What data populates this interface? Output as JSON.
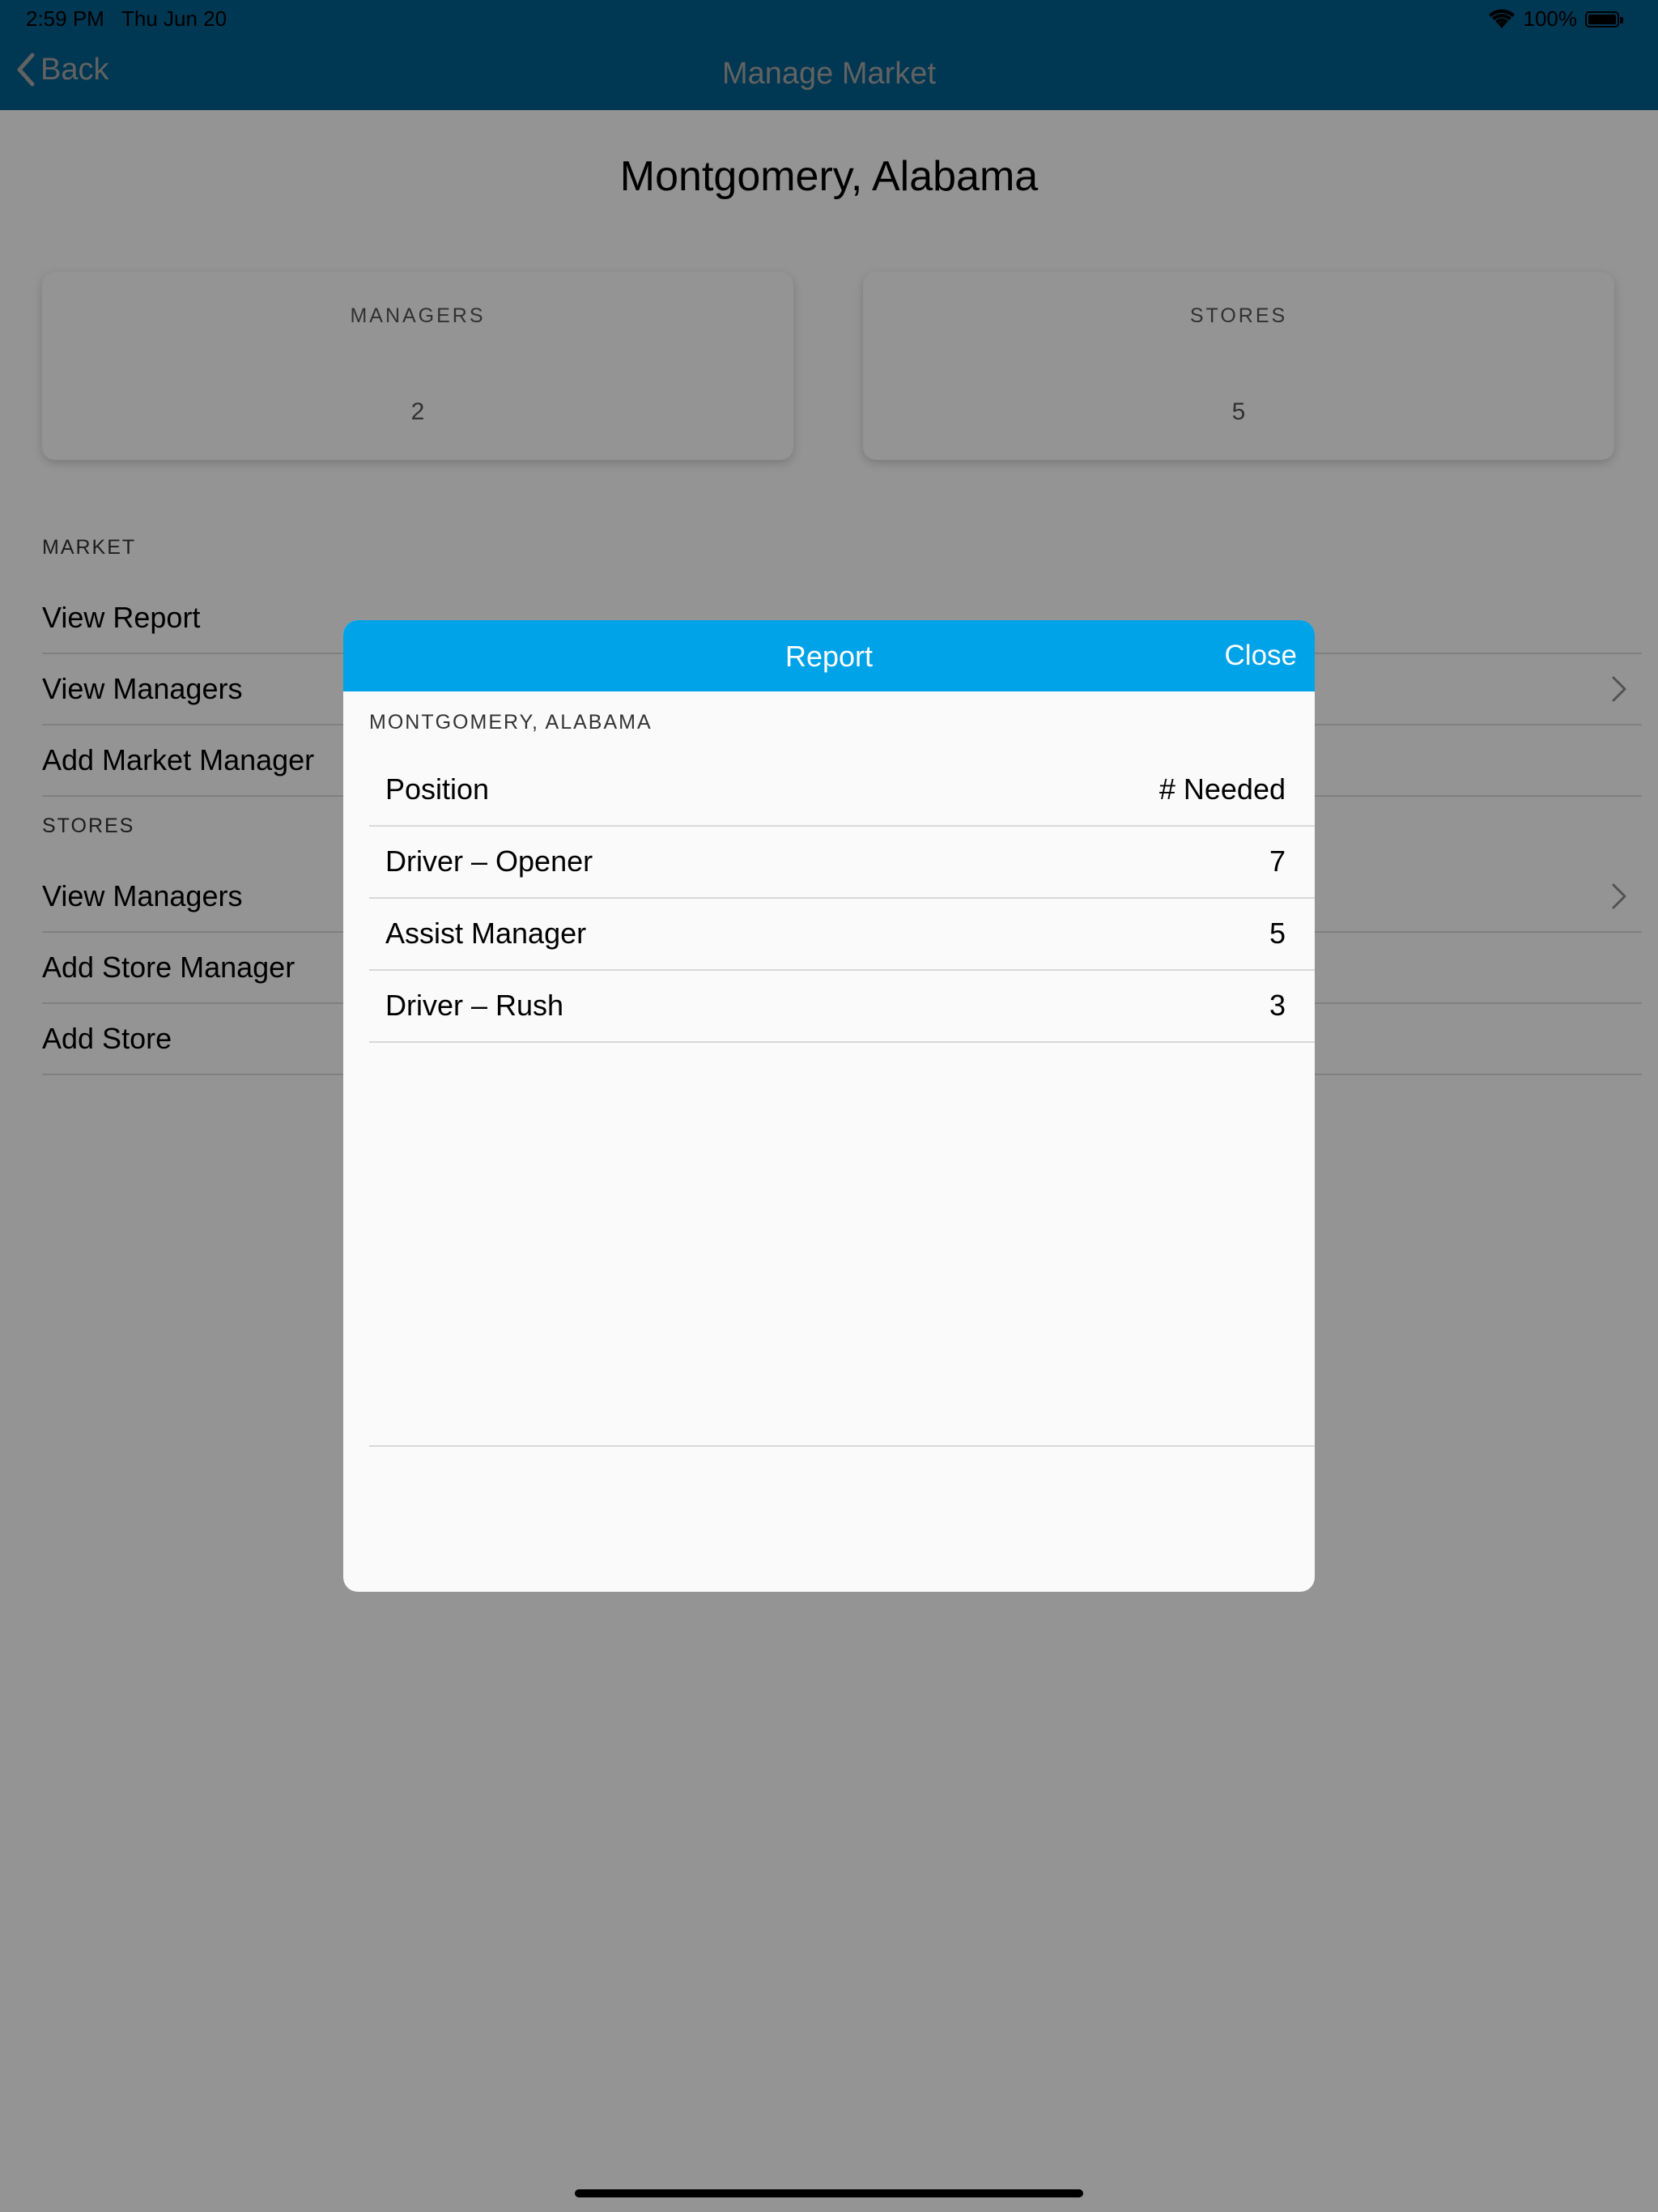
{
  "status_bar": {
    "time": "2:59 PM",
    "date": "Thu Jun 20",
    "battery": "100%"
  },
  "nav": {
    "back_label": "Back",
    "title": "Manage Market"
  },
  "page": {
    "title": "Montgomery, Alabama",
    "cards": [
      {
        "label": "MANAGERS",
        "value": "2"
      },
      {
        "label": "STORES",
        "value": "5"
      }
    ],
    "market_section": {
      "header": "MARKET",
      "items": [
        {
          "label": "View Report"
        },
        {
          "label": "View Managers"
        },
        {
          "label": "Add Market Manager"
        }
      ]
    },
    "stores_section": {
      "header": "STORES",
      "items": [
        {
          "label": "View Managers"
        },
        {
          "label": "Add Store Manager"
        },
        {
          "label": "Add Store"
        }
      ]
    }
  },
  "modal": {
    "title": "Report",
    "close_label": "Close",
    "subtitle": "MONTGOMERY, ALABAMA",
    "columns": [
      "Position",
      "# Needed"
    ],
    "rows": [
      {
        "position": "Driver – Opener",
        "needed": "7"
      },
      {
        "position": "Assist Manager",
        "needed": "5"
      },
      {
        "position": "Driver – Rush",
        "needed": "3"
      }
    ]
  },
  "colors": {
    "nav_bar": "#005f8e",
    "modal_header": "#00a2e8"
  }
}
